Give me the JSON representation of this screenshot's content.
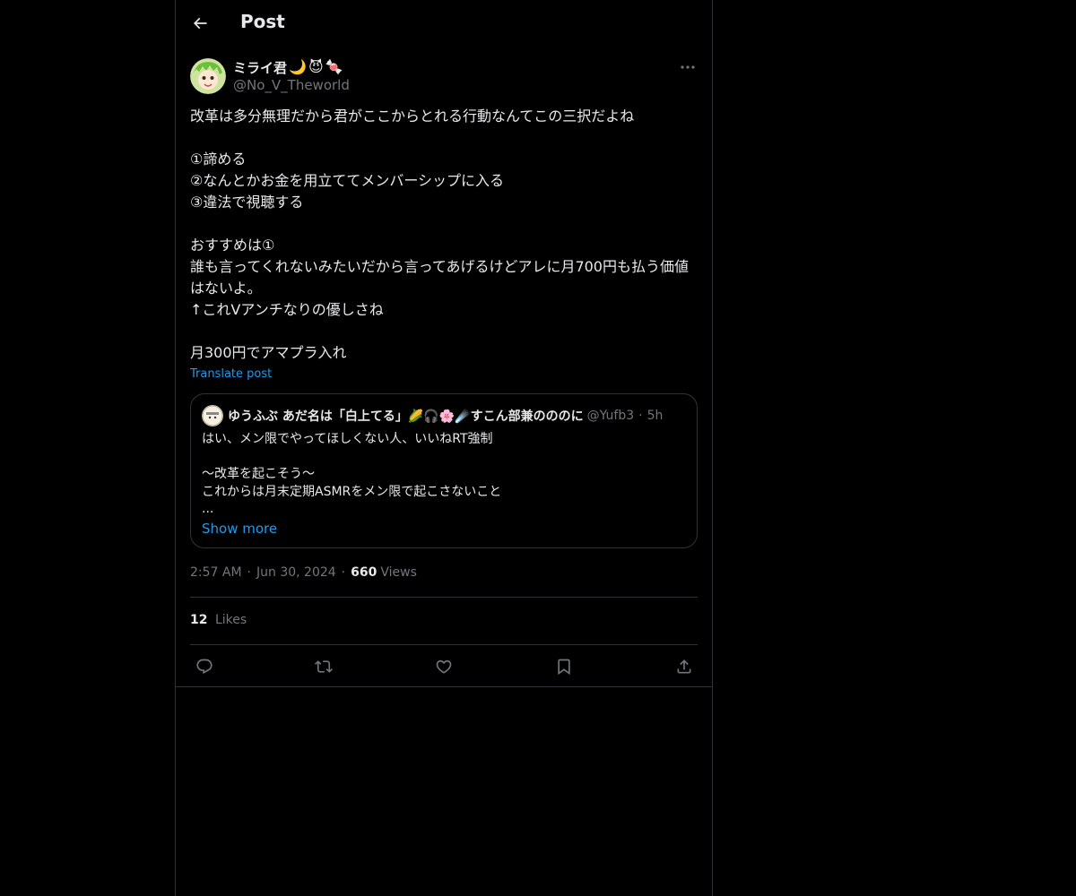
{
  "header": {
    "title": "Post",
    "back_icon": "arrow-left-icon"
  },
  "author": {
    "name": "ミライ君",
    "name_emojis": [
      "🌙",
      "😈",
      "🍬"
    ],
    "handle": "@No_V_Theworld"
  },
  "post": {
    "text": "改革は多分無理だから君がここからとれる行動なんてこの三択だよね\n\n①諦める\n②なんとかお金を用立ててメンバーシップに入る\n③違法で視聴する\n\nおすすめは①\n誰も言ってくれないみたいだから言ってあげるけどアレに月700円も払う価値はないよ。\n↑これVアンチなりの優しさね\n\n月300円でアマプラ入れ",
    "translate_label": "Translate post"
  },
  "quote": {
    "name": "ゆうふぶ あだ名は「白上てる」🌽🎧🌸☄️すこん部兼のののに",
    "handle": "@Yufb3",
    "dot": "·",
    "time": "5h",
    "text": "はい、メン限でやってほしくない人、いいねRT強制\n\n〜改革を起こそう〜\nこれからは月末定期ASMRをメン限で起こさないこと\n...",
    "show_more": "Show more"
  },
  "meta": {
    "time": "2:57 AM",
    "dot": "·",
    "date": "Jun 30, 2024",
    "views_count": "660",
    "views_label": "Views"
  },
  "likes": {
    "count": "12",
    "label": "Likes"
  },
  "actions": [
    "reply-icon",
    "repost-icon",
    "like-icon",
    "bookmark-icon",
    "share-icon"
  ],
  "colors": {
    "background": "#000000",
    "text": "#e7e9ea",
    "secondary": "#71767b",
    "accent": "#1d9bf0",
    "border": "#2f3336"
  }
}
